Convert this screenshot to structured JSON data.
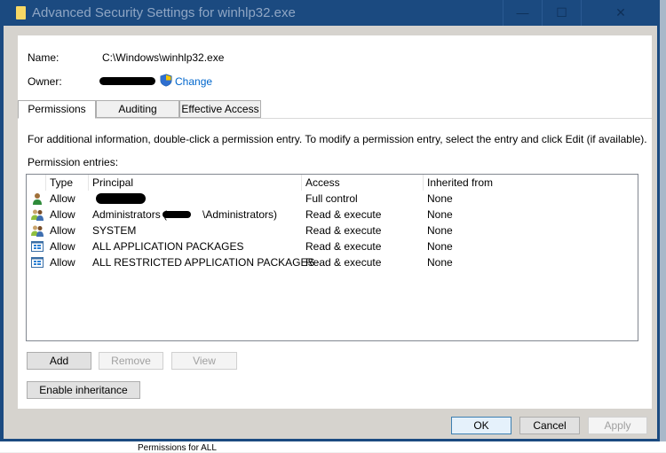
{
  "window": {
    "title": "Advanced Security Settings for winhlp32.exe",
    "minimize": "—",
    "maximize": "☐",
    "close": "✕"
  },
  "name": {
    "label": "Name:",
    "value": "C:\\Windows\\winhlp32.exe"
  },
  "owner": {
    "label": "Owner:",
    "change": "Change"
  },
  "tabs": [
    {
      "label": "Permissions",
      "active": true
    },
    {
      "label": "Auditing"
    },
    {
      "label": "Effective Access"
    }
  ],
  "info": "For additional information, double-click a permission entry. To modify a permission entry, select the entry and click Edit (if available).",
  "entries_label": "Permission entries:",
  "columns": [
    "Type",
    "Principal",
    "Access",
    "Inherited from"
  ],
  "rows": [
    {
      "icon": "user-icon",
      "type": "Allow",
      "principal": "",
      "access": "Full control",
      "inherited": "None"
    },
    {
      "icon": "group-icon",
      "type": "Allow",
      "principal": "Administrators (            \\Administrators)",
      "access": "Read & execute",
      "inherited": "None"
    },
    {
      "icon": "group-icon",
      "type": "Allow",
      "principal": "SYSTEM",
      "access": "Read & execute",
      "inherited": "None"
    },
    {
      "icon": "app-packages-icon",
      "type": "Allow",
      "principal": "ALL APPLICATION PACKAGES",
      "access": "Read & execute",
      "inherited": "None"
    },
    {
      "icon": "app-packages-icon",
      "type": "Allow",
      "principal": "ALL RESTRICTED APPLICATION PACKAGES",
      "access": "Read & execute",
      "inherited": "None"
    }
  ],
  "buttons": {
    "add": "Add",
    "remove": "Remove",
    "view": "View",
    "enable_inheritance": "Enable inheritance",
    "ok": "OK",
    "cancel": "Cancel",
    "apply": "Apply"
  },
  "background_text": "Permissions for ALL"
}
